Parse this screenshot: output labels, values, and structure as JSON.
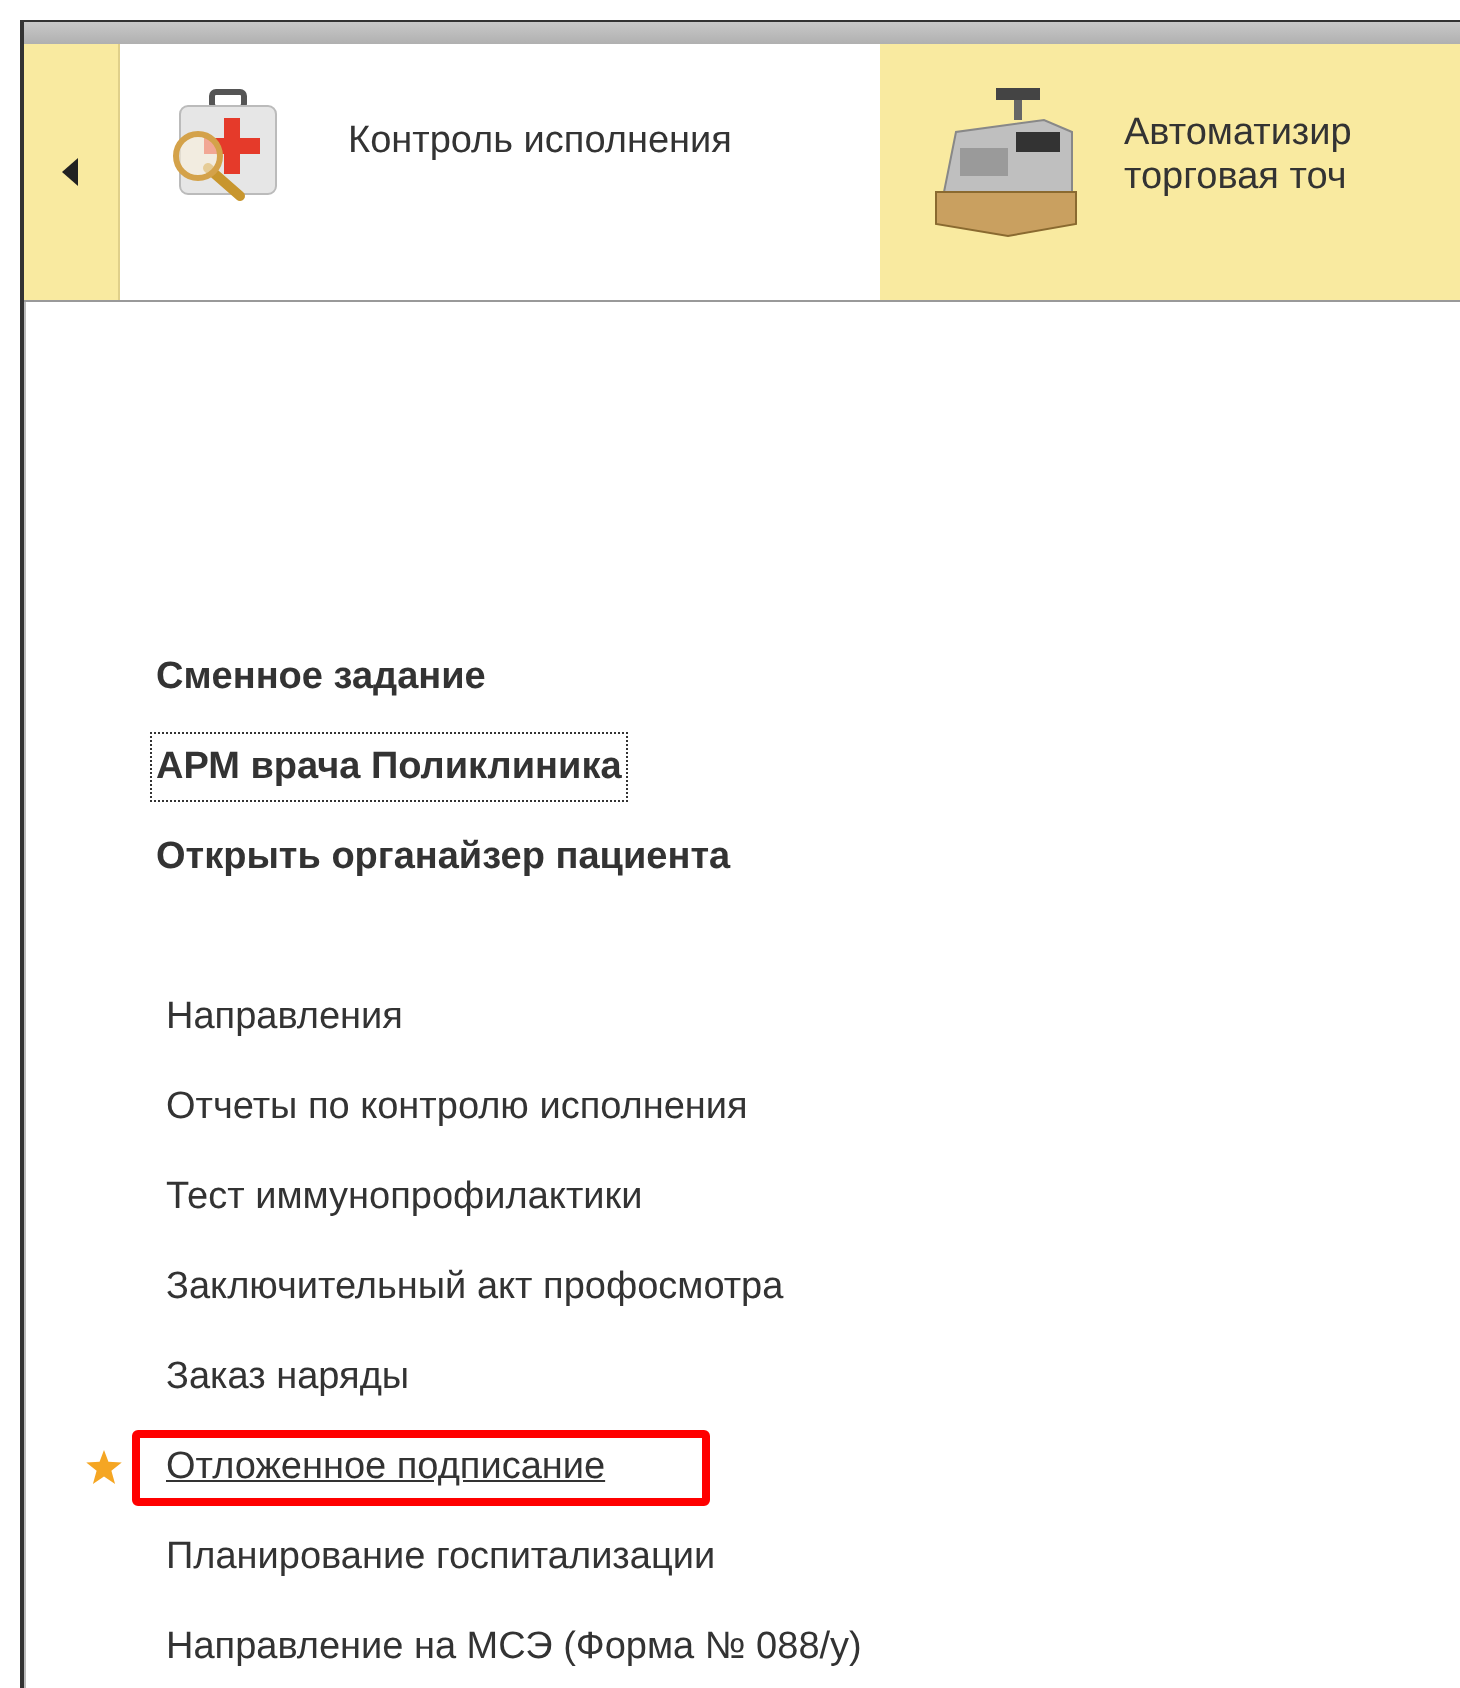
{
  "tabs": [
    {
      "label": "Контроль исполнения",
      "selected": true
    },
    {
      "label": "Автоматизир\nторговая точ",
      "selected": false
    }
  ],
  "commands": [
    {
      "label": "Сменное задание",
      "focused": false
    },
    {
      "label": "АРМ врача Поликлиника",
      "focused": true
    },
    {
      "label": "Открыть органайзер пациента",
      "focused": false
    }
  ],
  "items": [
    {
      "label": "Направления",
      "starred": false,
      "hovered": false,
      "highlighted": false
    },
    {
      "label": "Отчеты по контролю исполнения",
      "starred": false,
      "hovered": false,
      "highlighted": false
    },
    {
      "label": "Тест иммунопрофилактики",
      "starred": false,
      "hovered": false,
      "highlighted": false
    },
    {
      "label": "Заключительный акт профосмотра",
      "starred": false,
      "hovered": false,
      "highlighted": false
    },
    {
      "label": "Заказ наряды",
      "starred": false,
      "hovered": false,
      "highlighted": false
    },
    {
      "label": "Отложенное подписание",
      "starred": true,
      "hovered": true,
      "highlighted": true
    },
    {
      "label": "Планирование госпитализации",
      "starred": false,
      "hovered": false,
      "highlighted": false
    },
    {
      "label": "Направление на МСЭ (Форма № 088/у)",
      "starred": false,
      "hovered": false,
      "highlighted": false
    }
  ]
}
